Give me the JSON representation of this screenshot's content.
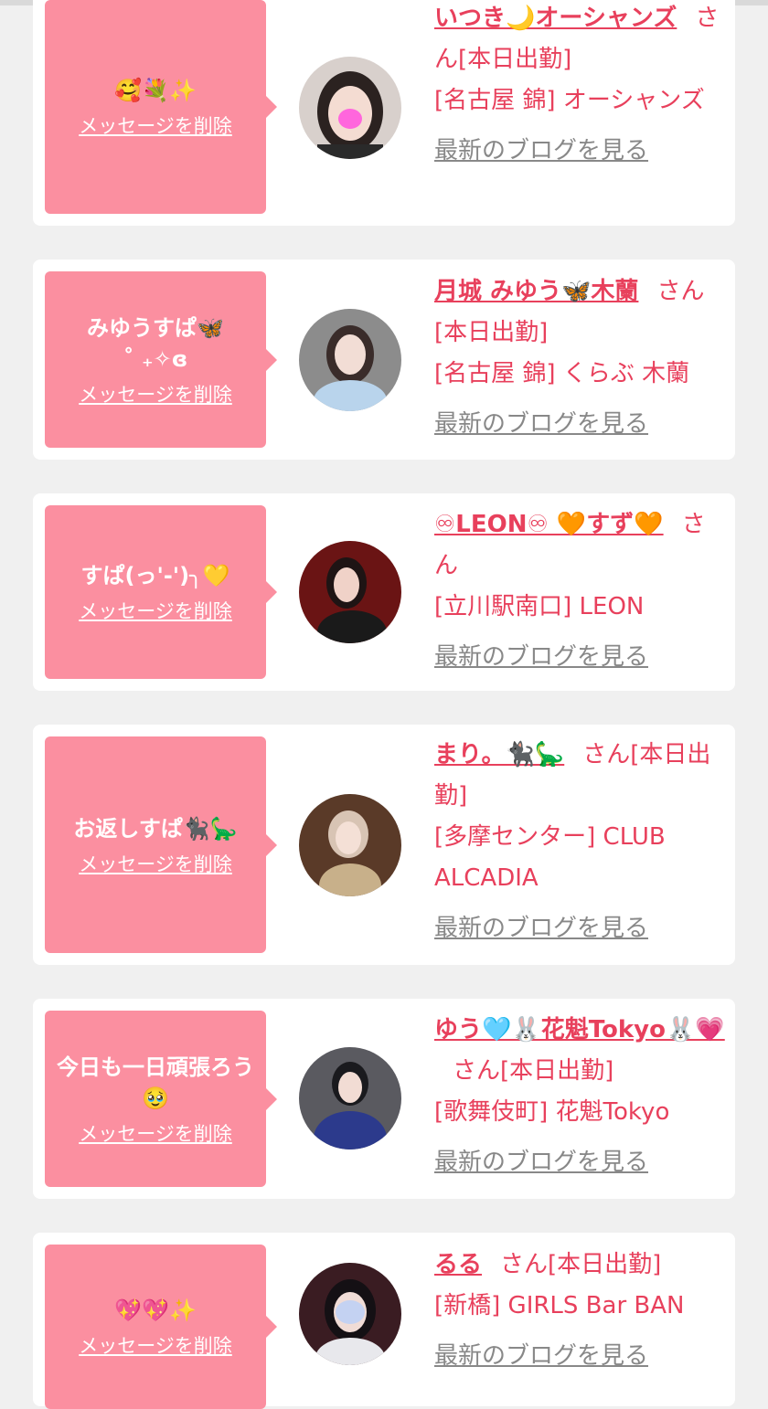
{
  "accent_color": "#e8405c",
  "bubble_color": "#fb8fa0",
  "delete_label": "メッセージを削除",
  "blog_label": "最新のブログを見る",
  "entries": [
    {
      "message": "🥰💐✨",
      "name": "いつき🌙オーシャンズ",
      "honorific": "さん",
      "status": "[本日出勤]",
      "shop": "[名古屋 錦] オーシャンズ"
    },
    {
      "message": "みゆうすぱ🦋\n˚ ₊✧ɞ",
      "name": "月城 みゆう🦋木蘭",
      "honorific": "さん",
      "status": "[本日出勤]",
      "shop": "[名古屋 錦] くらぶ 木蘭"
    },
    {
      "message": "すぱ(っ'-')╮💛",
      "name": "♾LEON♾ 🧡すず🧡",
      "honorific": "さん",
      "status": "",
      "shop": "[立川駅南口] LEON"
    },
    {
      "message": "お返しすぱ🐈‍⬛🦕",
      "name": "まり。🐈‍⬛🦕",
      "honorific": "さん",
      "status": "[本日出勤]",
      "shop": "[多摩センター] CLUB ALCADIA"
    },
    {
      "message": "今日も一日頑張ろう🥹",
      "name": "ゆう🩵🐰花魁Tokyo🐰💗",
      "honorific": "さん",
      "status": "[本日出勤]",
      "shop": "[歌舞伎町] 花魁Tokyo"
    },
    {
      "message": "💖💖✨",
      "name": "るる",
      "honorific": "さん",
      "status": "[本日出勤]",
      "shop": "[新橋] GIRLS Bar BAN"
    }
  ]
}
